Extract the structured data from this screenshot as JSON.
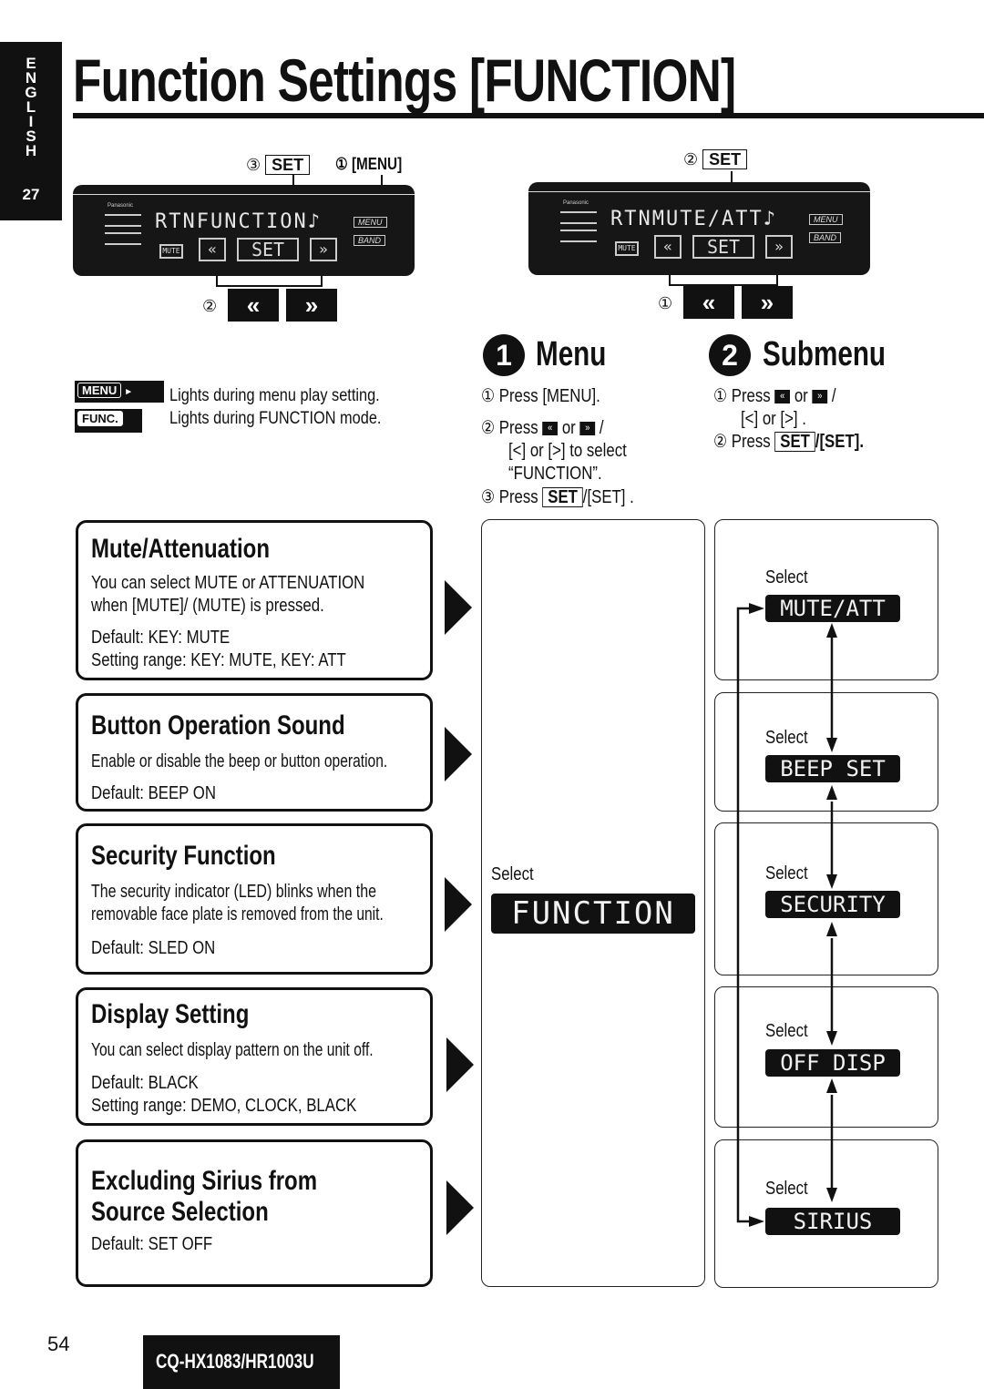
{
  "side_tab": {
    "language_letters": [
      "E",
      "N",
      "G",
      "L",
      "I",
      "S",
      "H"
    ],
    "section_number": "27"
  },
  "title": "Function Settings [FUNCTION]",
  "display_left": {
    "callout_step3_num": "③",
    "callout_step3_key": "SET",
    "callout_step1": "① [MENU]",
    "lcd_text": "RTNFUNCTION♪",
    "lcd_center_key": "SET",
    "lcd_mute": "MUTE",
    "lcd_menu": "MENU",
    "lcd_band": "BAND",
    "lcd_brand": "Panasonic",
    "callout_step2": "②",
    "seek_left_icon": "«",
    "seek_right_icon": "»"
  },
  "display_right": {
    "callout_step2_num": "②",
    "callout_step2_key": "SET",
    "lcd_text": "RTNMUTE/ATT♪",
    "lcd_center_key": "SET",
    "lcd_mute": "MUTE",
    "lcd_menu": "MENU",
    "lcd_band": "BAND",
    "lcd_brand": "Panasonic",
    "callout_step1": "①",
    "seek_left_icon": "«",
    "seek_right_icon": "»"
  },
  "legend": [
    {
      "key": "MENU",
      "suffix": "►",
      "text": "Lights during menu play setting."
    },
    {
      "key": "FUNC.",
      "text": "Lights during FUNCTION mode."
    }
  ],
  "menu_section": {
    "number": "1",
    "heading": "Menu",
    "steps": [
      {
        "num": "①",
        "text": "Press [MENU]."
      },
      {
        "num": "②",
        "text": "Press",
        "or": "or",
        "tail": "/"
      },
      {
        "line": "[<] or [>] to select"
      },
      {
        "line": "“FUNCTION”."
      },
      {
        "num": "③",
        "text": "Press",
        "key": "SET",
        "tail": "/[SET] ."
      }
    ]
  },
  "submenu_section": {
    "number": "2",
    "heading": "Submenu",
    "steps": [
      {
        "num": "①",
        "text": "Press",
        "or": "or",
        "tail": "/"
      },
      {
        "line": "[<] or [>] ."
      },
      {
        "num": "②",
        "text": "Press",
        "key": "SET",
        "tail": "/[SET]."
      }
    ]
  },
  "settings": [
    {
      "title": "Mute/Attenuation",
      "desc": [
        "You can select MUTE or ATTENUATION",
        "when [MUTE]/ (MUTE) is pressed."
      ],
      "default": "Default: KEY: MUTE",
      "range": "Setting range: KEY: MUTE, KEY: ATT"
    },
    {
      "title": "Button Operation Sound",
      "desc": [
        "Enable or disable the beep or button operation."
      ],
      "default": "Default: BEEP ON"
    },
    {
      "title": "Security Function",
      "desc": [
        "The security indicator (LED) blinks when the",
        "removable face plate is removed from the unit."
      ],
      "default": "Default: SLED ON"
    },
    {
      "title": "Display Setting",
      "desc": [
        "You can select display pattern on the unit off."
      ],
      "default": "Default: BLACK",
      "range": "Setting range: DEMO, CLOCK, BLACK"
    },
    {
      "title_lines": [
        "Excluding Sirius from",
        "Source Selection"
      ],
      "default": "Default: SET OFF"
    }
  ],
  "menu_flow": {
    "select_label": "Select",
    "lcd": "FUNCTION"
  },
  "submenu_flow": [
    {
      "select_label": "Select",
      "lcd": "MUTE/ATT"
    },
    {
      "select_label": "Select",
      "lcd": "BEEP SET"
    },
    {
      "select_label": "Select",
      "lcd": "SECURITY"
    },
    {
      "select_label": "Select",
      "lcd": "OFF DISP"
    },
    {
      "select_label": "Select",
      "lcd": "SIRIUS"
    }
  ],
  "footer": {
    "page_number": "54",
    "model": "CQ-HX1083/HR1003U"
  }
}
